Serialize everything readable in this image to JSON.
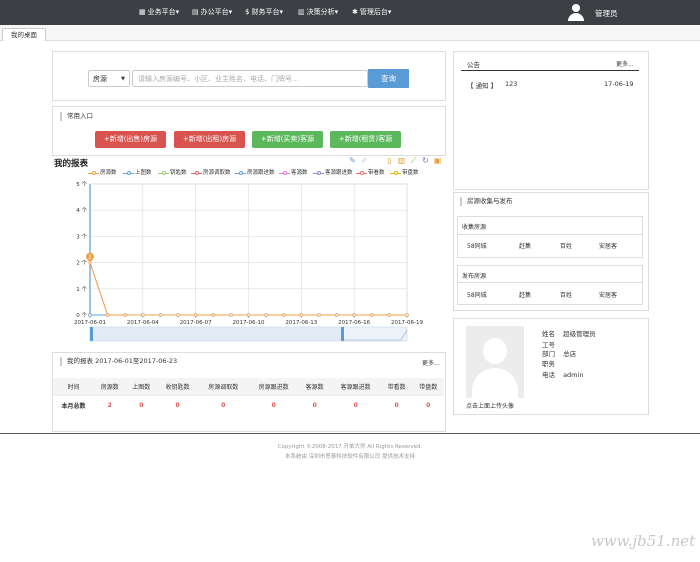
{
  "nav": {
    "items": [
      {
        "icon": "grid-icon",
        "glyph": "▦",
        "label": "业务平台"
      },
      {
        "icon": "calendar-icon",
        "glyph": "▤",
        "label": "办公平台"
      },
      {
        "icon": "dollar-icon",
        "glyph": "$",
        "label": "财务平台"
      },
      {
        "icon": "bar-chart-icon",
        "glyph": "▥",
        "label": "决策分析"
      },
      {
        "icon": "gear-icon",
        "glyph": "✱",
        "label": "管理后台"
      }
    ],
    "user": "管理员"
  },
  "tabs": [
    "我的桌面"
  ],
  "search": {
    "select": "房源",
    "placeholder": "请输入房源编号、小区、业主姓名、电话、门牌号...",
    "button": "查询"
  },
  "quick": {
    "title": "常用入口",
    "buttons": [
      "+新增(出售)房源",
      "+新增(出租)房源",
      "+新增(买卖)客源",
      "+新增(租赁)客源"
    ]
  },
  "chart_data": {
    "type": "line",
    "title": "我的报表",
    "categories": [
      "2017-06-01",
      "2017-06-02",
      "2017-06-03",
      "2017-06-04",
      "2017-06-05",
      "2017-06-06",
      "2017-06-07",
      "2017-06-08",
      "2017-06-09",
      "2017-06-10",
      "2017-06-11",
      "2017-06-12",
      "2017-06-13",
      "2017-06-14",
      "2017-06-15",
      "2017-06-16",
      "2017-06-17",
      "2017-06-18",
      "2017-06-19"
    ],
    "x_tick_labels": [
      "2017-06-01",
      "2017-06-04",
      "2017-06-07",
      "2017-06-10",
      "2017-06-13",
      "2017-06-16",
      "2017-06-19"
    ],
    "y_tick_labels": [
      "0 个",
      "1 个",
      "2 个",
      "3 个",
      "4 个",
      "5 个"
    ],
    "ylim": [
      0,
      5
    ],
    "grid": true,
    "legend_position": "top",
    "series": [
      {
        "name": "房源数",
        "color": "#f0a04b",
        "values": [
          2,
          0,
          0,
          0,
          0,
          0,
          0,
          0,
          0,
          0,
          0,
          0,
          0,
          0,
          0,
          0,
          0,
          0,
          0
        ]
      },
      {
        "name": "上图数",
        "color": "#5aa5e0",
        "values": [
          0,
          0,
          0,
          0,
          0,
          0,
          0,
          0,
          0,
          0,
          0,
          0,
          0,
          0,
          0,
          0,
          0,
          0,
          0
        ]
      },
      {
        "name": "钥匙数",
        "color": "#9ccc65",
        "values": [
          0,
          0,
          0,
          0,
          0,
          0,
          0,
          0,
          0,
          0,
          0,
          0,
          0,
          0,
          0,
          0,
          0,
          0,
          0
        ]
      },
      {
        "name": "房源调取数",
        "color": "#e06666",
        "values": [
          0,
          0,
          0,
          0,
          0,
          0,
          0,
          0,
          0,
          0,
          0,
          0,
          0,
          0,
          0,
          0,
          0,
          0,
          0
        ]
      },
      {
        "name": "房源跟进数",
        "color": "#6aa0d8",
        "values": [
          0,
          0,
          0,
          0,
          0,
          0,
          0,
          0,
          0,
          0,
          0,
          0,
          0,
          0,
          0,
          0,
          0,
          0,
          0
        ]
      },
      {
        "name": "客源数",
        "color": "#d97ad9",
        "values": [
          0,
          0,
          0,
          0,
          0,
          0,
          0,
          0,
          0,
          0,
          0,
          0,
          0,
          0,
          0,
          0,
          0,
          0,
          0
        ]
      },
      {
        "name": "客源跟进数",
        "color": "#9b7fd4",
        "values": [
          0,
          0,
          0,
          0,
          0,
          0,
          0,
          0,
          0,
          0,
          0,
          0,
          0,
          0,
          0,
          0,
          0,
          0,
          0
        ]
      },
      {
        "name": "带看数",
        "color": "#e57373",
        "values": [
          0,
          0,
          0,
          0,
          0,
          0,
          0,
          0,
          0,
          0,
          0,
          0,
          0,
          0,
          0,
          0,
          0,
          0,
          0
        ]
      },
      {
        "name": "带盘数",
        "color": "#e6b400",
        "values": [
          0,
          0,
          0,
          0,
          0,
          0,
          0,
          0,
          0,
          0,
          0,
          0,
          0,
          0,
          0,
          0,
          0,
          0,
          0
        ]
      }
    ]
  },
  "chart_tools": [
    {
      "name": "brush-icon",
      "glyph": "✎",
      "color": "#5b9bd5"
    },
    {
      "name": "pencil-icon",
      "glyph": "✐",
      "color": "#cfcfcf"
    },
    {
      "name": "dataview-icon",
      "glyph": "▯",
      "color": "#e0a040"
    },
    {
      "name": "bar-chart-icon",
      "glyph": "▥",
      "color": "#e0a040"
    },
    {
      "name": "line-chart-icon",
      "glyph": "⟋",
      "color": "#5cb85c"
    },
    {
      "name": "restore-icon",
      "glyph": "↻",
      "color": "#8a6bd1"
    },
    {
      "name": "save-image-icon",
      "glyph": "▣",
      "color": "#e0a040"
    }
  ],
  "report": {
    "title": "我的报表 2017-06-01至2017-06-23",
    "more": "更多...",
    "headers": [
      "时间",
      "房源数",
      "上图数",
      "收钥匙数",
      "房源调取数",
      "房源跟进数",
      "客源数",
      "客源跟进数",
      "带看数",
      "带盘数"
    ],
    "row": {
      "label": "本月总数",
      "values": [
        "2",
        "0",
        "0",
        "0",
        "0",
        "0",
        "0",
        "0",
        "0"
      ]
    }
  },
  "notice": {
    "title": "公告",
    "more": "更多...",
    "item": {
      "tag": "【 通知 】",
      "text": "123",
      "date": "17-06-19"
    }
  },
  "collect": {
    "title": "房源收集与发布",
    "collect_label": "收集房源",
    "publish_label": "发布房源",
    "sites": [
      "58同城",
      "赶集",
      "百姓",
      "安居客"
    ]
  },
  "profile": {
    "upload_hint": "点击上面上传头像",
    "fields": [
      {
        "label": "姓名",
        "value": "超级管理员"
      },
      {
        "label": "工号",
        "value": ""
      },
      {
        "label": "部门",
        "value": "总店"
      },
      {
        "label": "职务",
        "value": ""
      },
      {
        "label": "电话",
        "value": "admin"
      }
    ]
  },
  "footer": {
    "line1": "Copyright ©2008-2017 开单大师 All Rights Reserved.",
    "line2": "本系统由 深圳市思泰科技软件有限公司 提供技术支持"
  },
  "watermark": "www.jb51.net"
}
